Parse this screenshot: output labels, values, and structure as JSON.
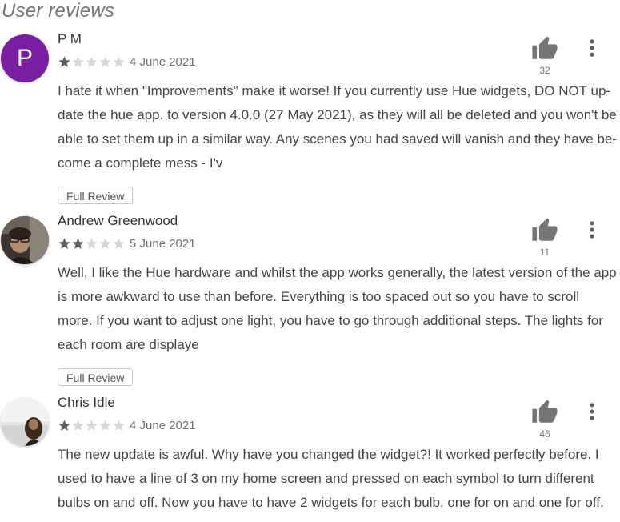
{
  "section_title": "User reviews",
  "colors": {
    "star_filled": "#5f5f5f",
    "star_empty": "#d8d8d8",
    "thumb": "#757575",
    "avatar_pm": "#7b1fa2"
  },
  "reviews": [
    {
      "author": "P M",
      "avatar_letter": "P",
      "avatar_type": "letter",
      "rating": 1,
      "rating_max": 5,
      "date": "4 June 2021",
      "helpful_count": "32",
      "body_lines": [
        "I hate it when \"Improvements\" make it worse! If you currently use Hue widgets, DO NOT up-",
        "date the hue app. to version 4.0.0 (27 May 2021), as they will all be deleted and you won't be",
        "able to set them up in a similar way. Any scenes you had saved will vanish and they have be-",
        "come a complete mess - I'v"
      ],
      "button_label": "Full Review"
    },
    {
      "author": "Andrew Greenwood",
      "avatar_type": "photo",
      "rating": 2,
      "rating_max": 5,
      "date": "5 June 2021",
      "helpful_count": "11",
      "body_lines": [
        "Well, I like the Hue hardware and whilst the app works generally, the latest version of the app",
        "is more awkward to use than before. Everything is too spaced out so you have to scroll",
        "more. If you want to adjust one light, you have to go through additional steps. The lights for",
        "each room are displaye"
      ],
      "button_label": "Full Review"
    },
    {
      "author": "Chris Idle",
      "avatar_type": "photo",
      "rating": 1,
      "rating_max": 5,
      "date": "4 June 2021",
      "helpful_count": "46",
      "body_lines": [
        "The new update is awful. Why have you changed the widget?! It worked perfectly before. I",
        "used to have a line of 3 on my home screen and pressed on each symbol to turn different",
        "bulbs on and off. Now you have to have 2 widgets for each bulb, one for on and one for off."
      ]
    }
  ]
}
